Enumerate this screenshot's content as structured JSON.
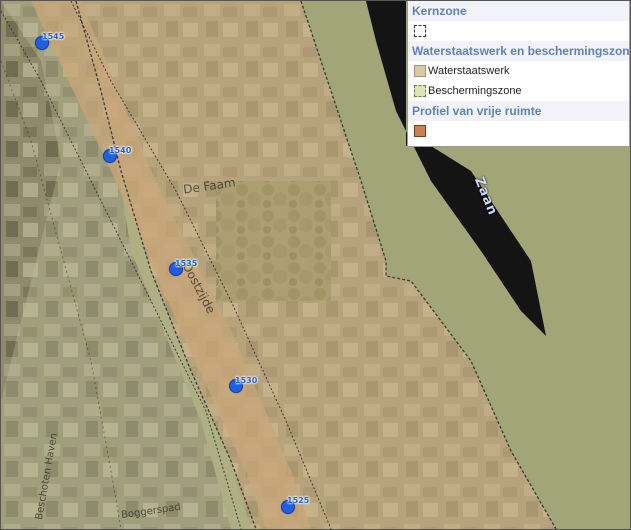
{
  "map": {
    "river_label": "Zaan",
    "street_labels": [
      "De Faam",
      "Oostzijde",
      "Beschoten Haven",
      "Boggerspad"
    ],
    "markers": [
      {
        "label": "1545"
      },
      {
        "label": "1540"
      },
      {
        "label": "1535"
      },
      {
        "label": "1530"
      },
      {
        "label": "1525"
      }
    ]
  },
  "legend": {
    "sections": [
      {
        "title": "Kernzone",
        "items": [
          {
            "label": "",
            "swatch": "kernzone"
          }
        ]
      },
      {
        "title": "Waterstaatswerk en beschermingszone",
        "items": [
          {
            "label": "Waterstaatswerk",
            "swatch": "waterstaatswerk"
          },
          {
            "label": "Beschermingszone",
            "swatch": "beschermingszone"
          }
        ]
      },
      {
        "title": "Profiel van vrije ruimte",
        "items": [
          {
            "label": "",
            "swatch": "profiel"
          }
        ]
      }
    ]
  },
  "colors": {
    "water": "#141414",
    "land_overlay": "#a4a67a",
    "waterstaatswerk": "#d9c9aa",
    "beschermingszone": "#dfe4b8",
    "profiel": "#c8814f",
    "marker": "#1f5fe0",
    "legend_header_text": "#5f82b9"
  }
}
